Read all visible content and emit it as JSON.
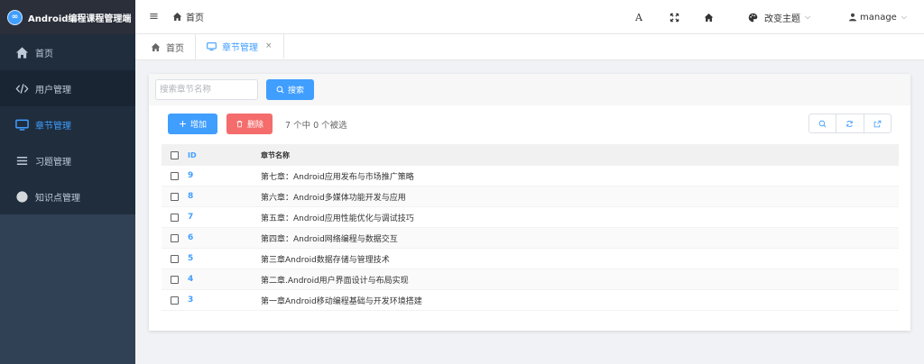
{
  "app": {
    "title": "Android编程课程管理端",
    "logo_glyph": "∞"
  },
  "sidebar": {
    "items": [
      {
        "label": "首页",
        "icon": "home-icon"
      },
      {
        "label": "用户管理",
        "icon": "code-icon"
      },
      {
        "label": "章节管理",
        "icon": "monitor-icon",
        "active": true
      },
      {
        "label": "习题管理",
        "icon": "list-icon"
      },
      {
        "label": "知识点管理",
        "icon": "dot-icon"
      }
    ]
  },
  "header": {
    "menu_glyph": "≡",
    "breadcrumb": "首页",
    "font_glyph": "A",
    "theme_label": "改变主题",
    "user_label": "manage",
    "chevron": "⌵"
  },
  "tabs": [
    {
      "label": "首页",
      "icon": "home-icon"
    },
    {
      "label": "章节管理",
      "icon": "monitor-icon",
      "active": true,
      "close": "×"
    }
  ],
  "search": {
    "placeholder": "搜索章节名称",
    "button_label": "搜索"
  },
  "actions": {
    "add_label": "增加",
    "delete_label": "删除",
    "selection_text": "7 个中 0 个被选"
  },
  "table": {
    "headers": {
      "id": "ID",
      "name": "章节名称"
    },
    "rows": [
      {
        "id": "9",
        "name": "第七章：Android应用发布与市场推广策略"
      },
      {
        "id": "8",
        "name": "第六章：Android多媒体功能开发与应用"
      },
      {
        "id": "7",
        "name": "第五章：Android应用性能优化与调试技巧"
      },
      {
        "id": "6",
        "name": "第四章：Android网络编程与数据交互"
      },
      {
        "id": "5",
        "name": "第三章Android数据存储与管理技术"
      },
      {
        "id": "4",
        "name": "第二章.Android用户界面设计与布局实现"
      },
      {
        "id": "3",
        "name": "第一章Android移动编程基础与开发环境搭建"
      }
    ]
  },
  "colors": {
    "primary": "#409eff",
    "danger": "#f56c6c",
    "sidebar": "#304156",
    "sidebar_menu": "#1f2d3d"
  }
}
